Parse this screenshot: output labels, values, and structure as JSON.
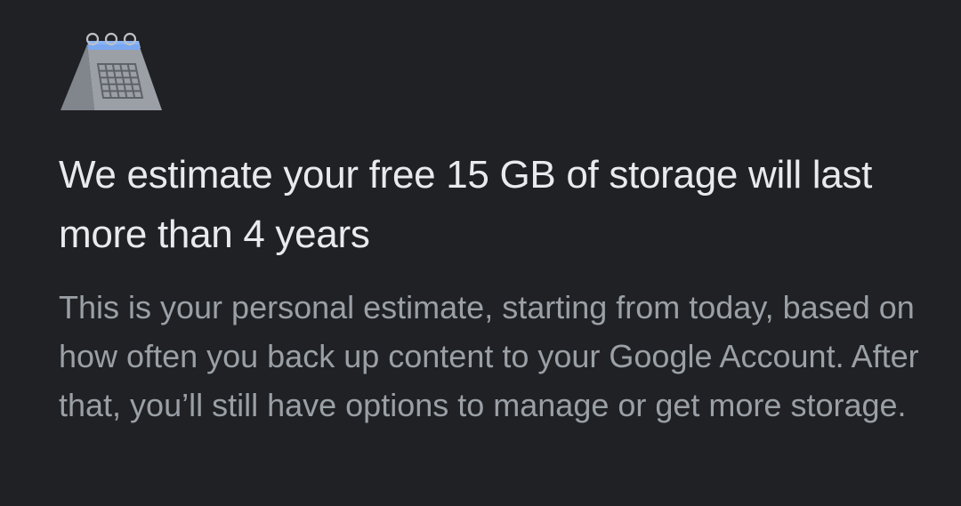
{
  "illustration": {
    "icon": "calendar-icon",
    "accent_color": "#8ab4f8",
    "body_color": "#9aa0a6"
  },
  "estimate": {
    "headline": "We estimate your free 15 GB of storage will last more than 4 years",
    "description": "This is your personal estimate, starting from today, based on how often you back up content to your Google Account. After that, you’ll still have options to manage or get more storage."
  },
  "colors": {
    "background": "#202124",
    "headline_text": "#e8eaed",
    "body_text": "#9aa0a6"
  }
}
